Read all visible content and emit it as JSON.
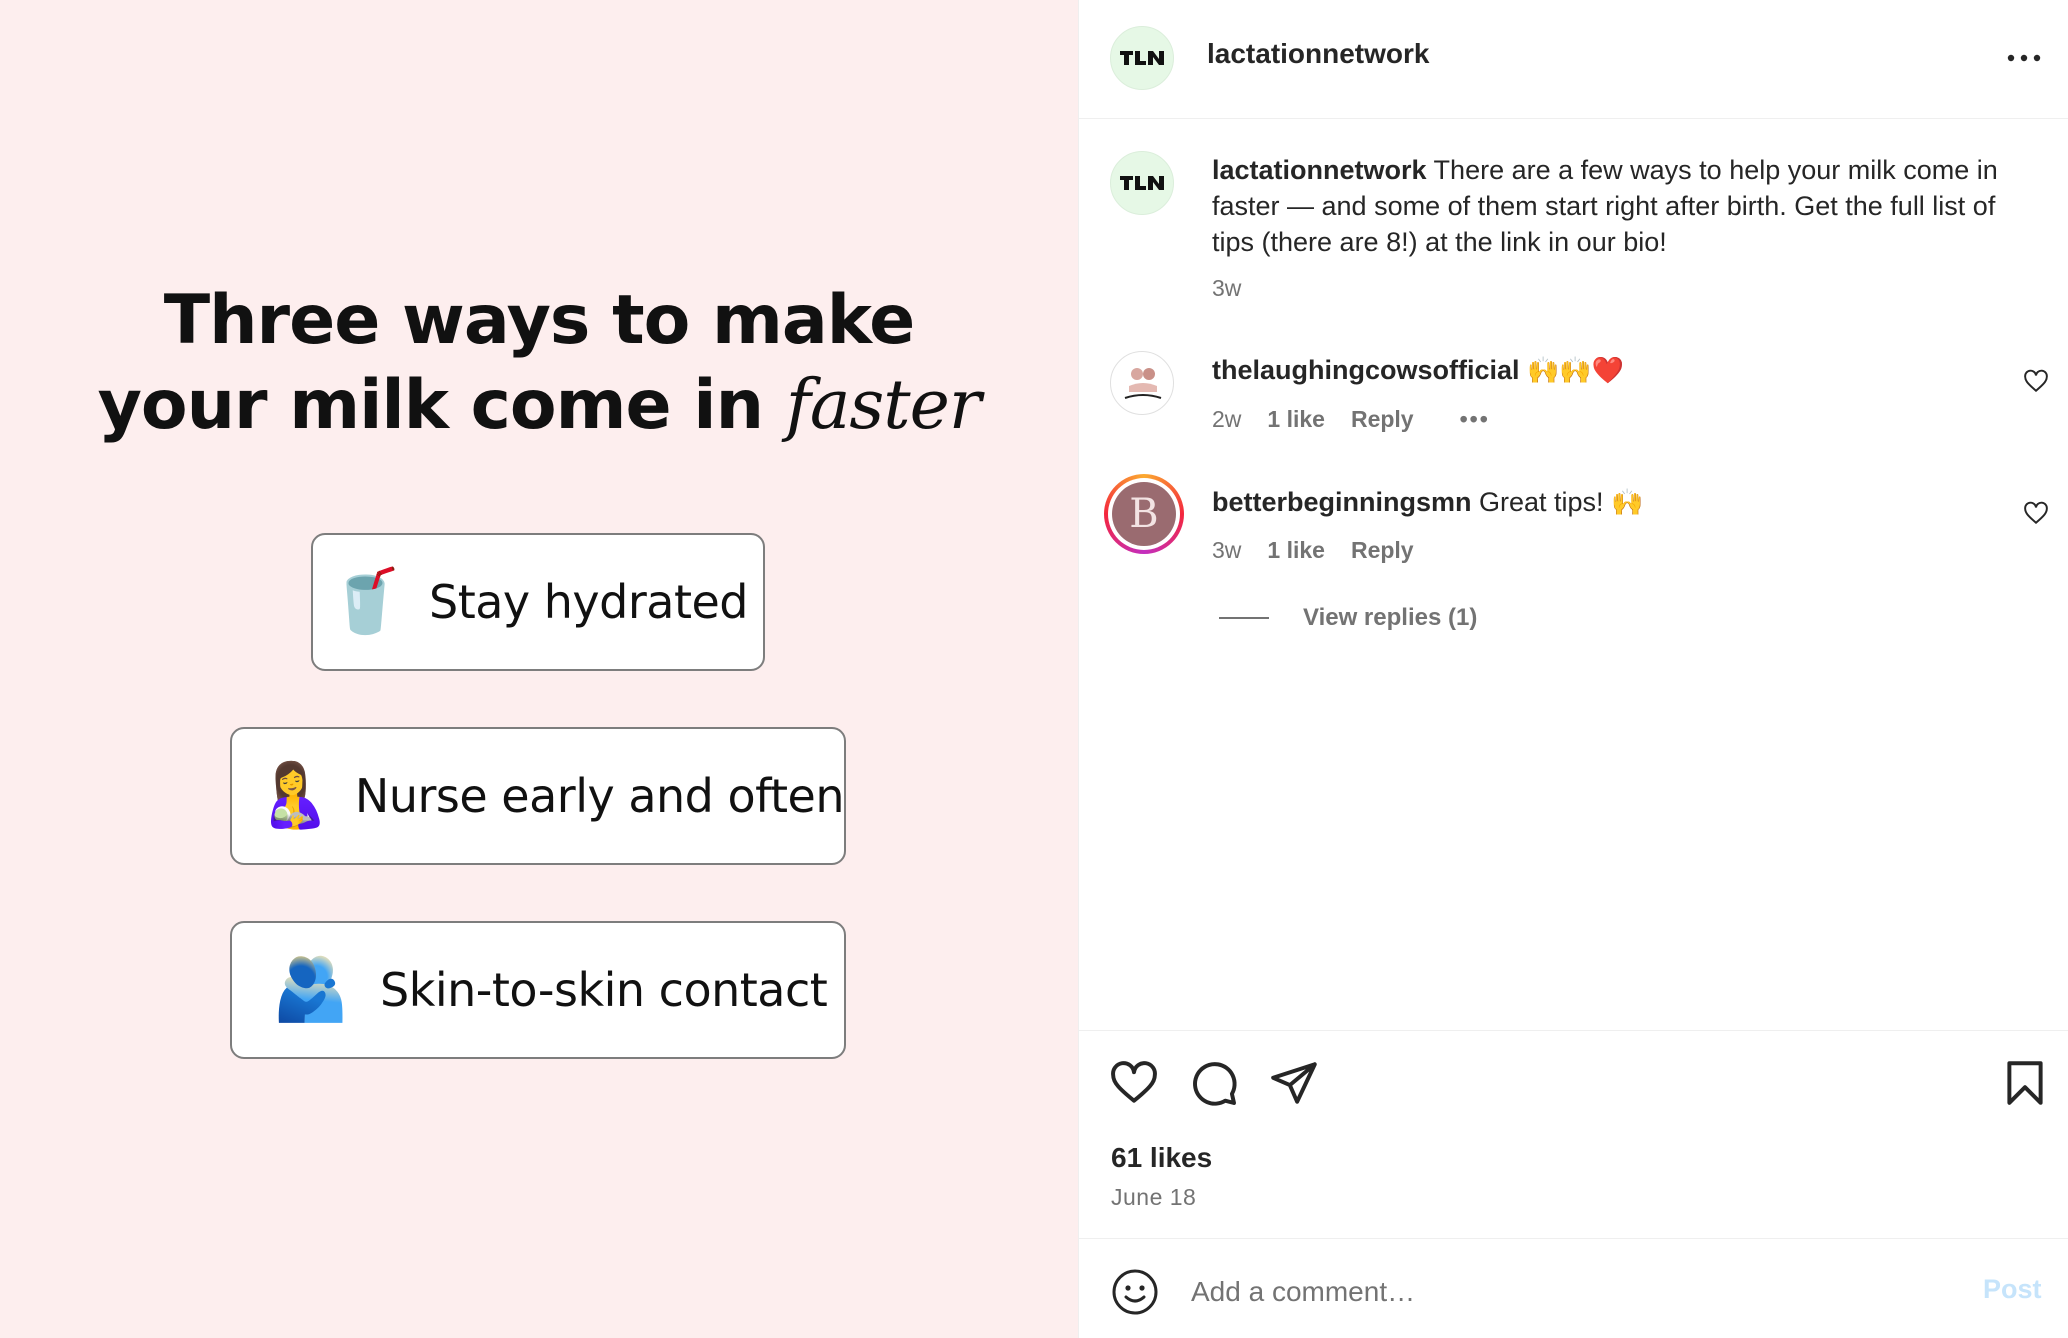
{
  "post_image": {
    "headline_line1": "Three ways to make",
    "headline_line2_pre": "your milk come in ",
    "headline_line2_italic": "faster",
    "tips": [
      {
        "emoji": "🥤",
        "label": "Stay hydrated"
      },
      {
        "emoji": "🤱",
        "label": "Nurse early and often"
      },
      {
        "emoji": "🫂",
        "label": "Skin-to-skin contact"
      }
    ]
  },
  "header": {
    "username": "lactationnetwork",
    "avatar_text": "TLN",
    "more_icon": "more-horizontal-icon"
  },
  "caption": {
    "username": "lactationnetwork",
    "text": " There are a few ways to help your milk come in faster — and some of them start right after birth. Get the full list of tips (there are 8!) at the link in our bio!",
    "time": "3w"
  },
  "comments": [
    {
      "username": "thelaughingcowsofficial",
      "text": "",
      "emoji": "🙌🙌❤️",
      "time": "2w",
      "likes": "1 like",
      "reply": "Reply",
      "more": "•••"
    },
    {
      "username": "betterbeginningsmn",
      "text": " Great tips! ",
      "emoji": "🙌",
      "avatar_letter": "B",
      "time": "3w",
      "likes": "1 like",
      "reply": "Reply",
      "view_replies": "View replies (1)"
    }
  ],
  "actions": {
    "likes": "61 likes",
    "date": "June 18"
  },
  "comment_box": {
    "placeholder": "Add a comment…",
    "post_label": "Post"
  },
  "colors": {
    "image_bg": "#fdeeee",
    "muted_text": "#737373",
    "post_button_disabled": "#c6e4fb",
    "avatar_bg": "#e6f8e6"
  }
}
